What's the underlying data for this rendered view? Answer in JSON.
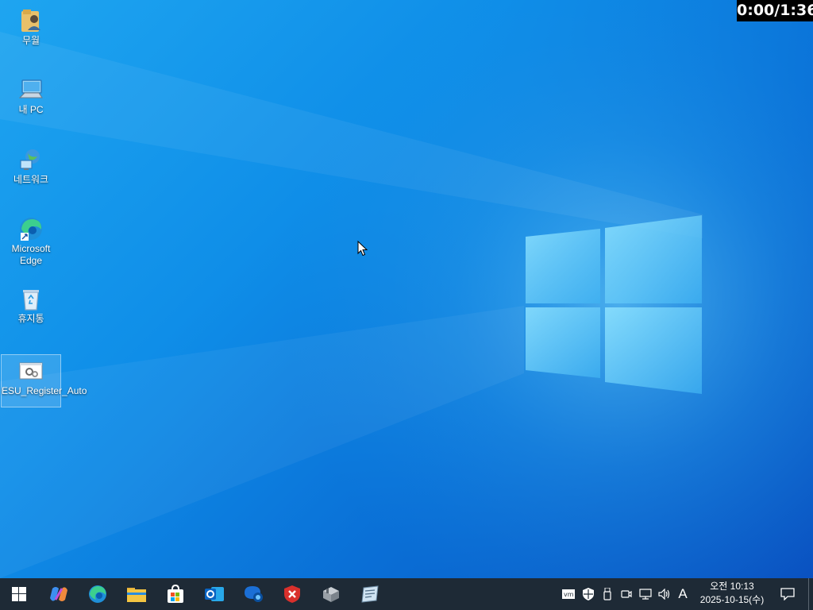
{
  "timer": "0:00/1:36",
  "desktop_icons": [
    {
      "label": "무월",
      "icon": "user-folder-icon"
    },
    {
      "label": "내 PC",
      "icon": "computer-icon"
    },
    {
      "label": "네트워크",
      "icon": "network-icon"
    },
    {
      "label": "Microsoft Edge",
      "icon": "edge-icon"
    },
    {
      "label": "휴지통",
      "icon": "recycle-bin-icon"
    },
    {
      "label": "ESU_Register_Auto",
      "icon": "script-gear-icon"
    }
  ],
  "taskbar": {
    "apps": [
      "start-icon",
      "copilot-icon",
      "edge-icon",
      "file-explorer-icon",
      "store-icon",
      "outlook-icon",
      "teams-icon",
      "security-icon",
      "package-icon",
      "notepad-icon"
    ],
    "tray": {
      "ime_indicator": "A",
      "time": "오전 10:13",
      "date": "2025-10-15(수)"
    }
  }
}
